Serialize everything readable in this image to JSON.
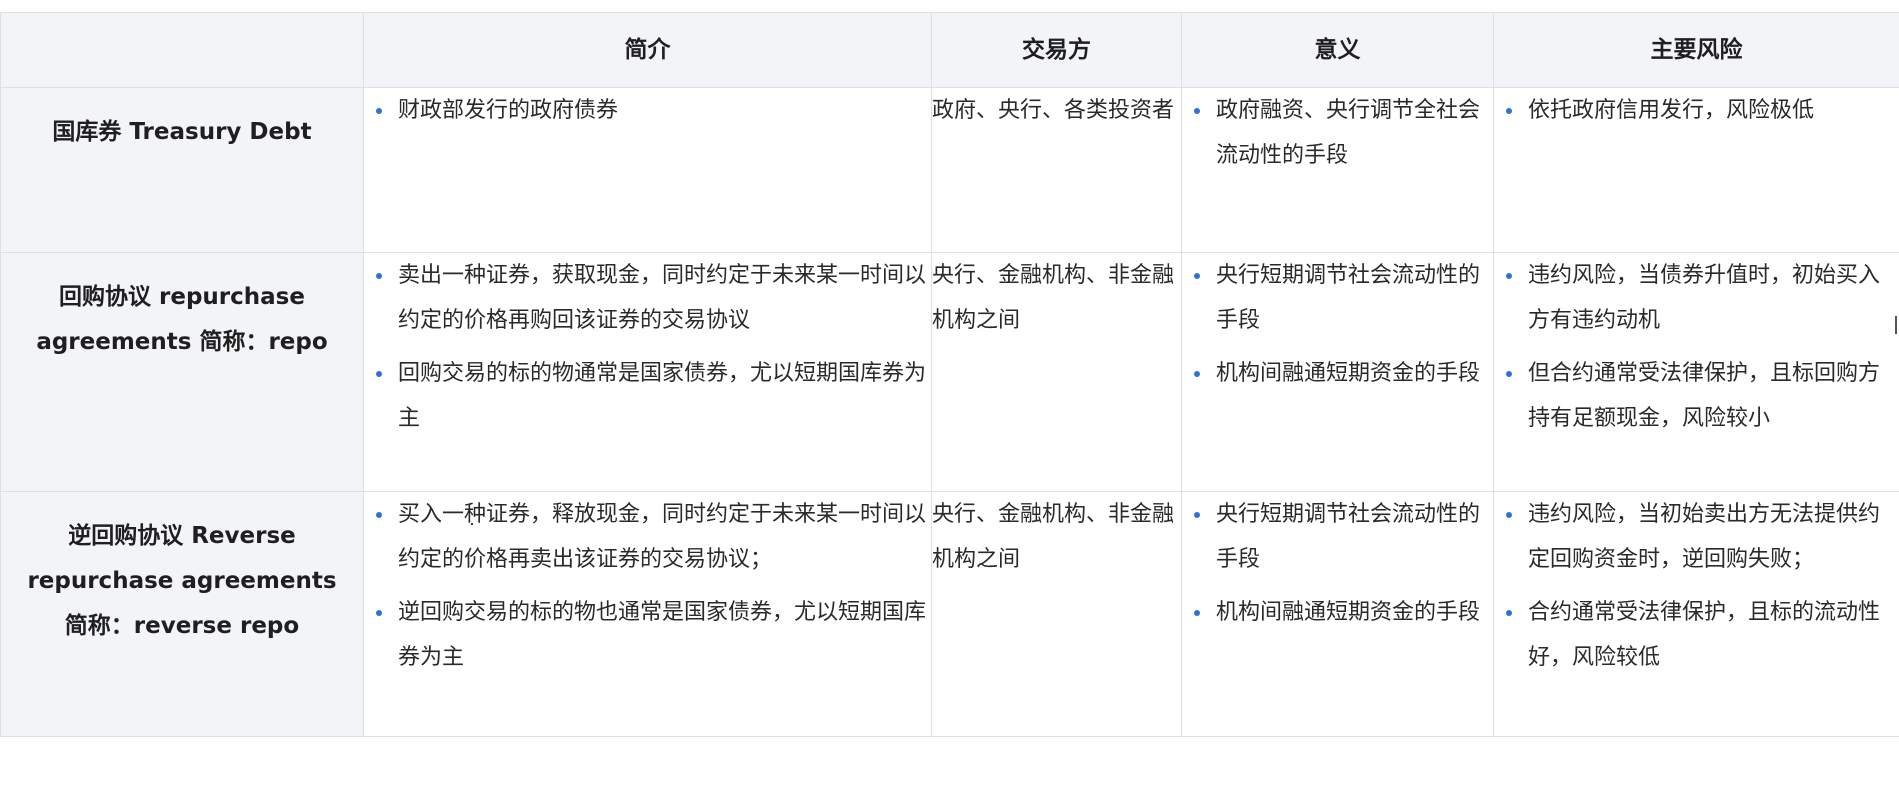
{
  "header": {
    "corner": "",
    "columns": [
      "简介",
      "交易方",
      "意义",
      "主要风险"
    ]
  },
  "rows": [
    {
      "name": "国库券 Treasury Debt",
      "intro": [
        "财政部发行的政府债券"
      ],
      "parties": "政府、央行、各类投资者",
      "meaning": [
        "政府融资、央行调节全社会流动性的手段"
      ],
      "risks": [
        "依托政府信用发行，风险极低"
      ]
    },
    {
      "name": "回购协议 repurchase agreements 简称：repo",
      "intro": [
        "卖出一种证券，获取现金，同时约定于未来某一时间以约定的价格再购回该证券的交易协议",
        "回购交易的标的物通常是国家债券，尤以短期国库券为主"
      ],
      "parties": "央行、金融机构、非金融机构之间",
      "meaning": [
        "央行短期调节社会流动性的手段",
        " 机构间融通短期资金的手段"
      ],
      "risks": [
        "违约风险，当债券升值时，初始买入方有违约动机",
        " 但合约通常受法律保护，且标回购方持有足额现金，风险较小"
      ]
    },
    {
      "name": "逆回购协议 Reverse repurchase agreements 简称：reverse repo",
      "intro": [
        "买入一种证券，释放现金，同时约定于未来某一时间以约定的价格再卖出该证券的交易协议；",
        "逆回购交易的标的物也通常是国家债券，尤以短期国库券为主"
      ],
      "parties": "央行、金融机构、非金融机构之间",
      "meaning": [
        "央行短期调节社会流动性的手段",
        "机构间融通短期资金的手段"
      ],
      "risks": [
        "违约风险，当初始卖出方无法提供约定回购资金时，逆回购失败；",
        "合约通常受法律保护，且标的流动性好，风险较低"
      ]
    }
  ],
  "colors": {
    "header_bg": "#f2f4f7",
    "border": "#dcdfe4",
    "bullet": "#2f6fde",
    "text": "#1f1f1f"
  }
}
